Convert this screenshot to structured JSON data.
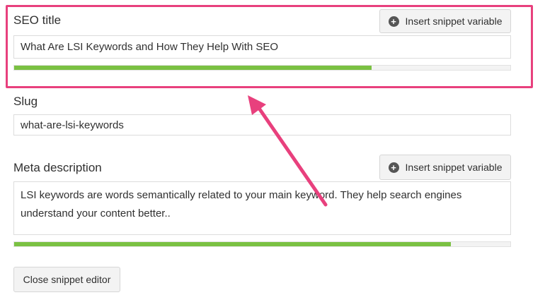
{
  "seo_title": {
    "label": "SEO title",
    "value": "What Are LSI Keywords and How They Help With SEO",
    "insert_button_label": "Insert snippet variable",
    "progress_percent": 72
  },
  "slug": {
    "label": "Slug",
    "value": "what-are-lsi-keywords"
  },
  "meta_description": {
    "label": "Meta description",
    "value": "LSI keywords are words semantically related to your main keyword. They help search engines understand your content better..",
    "insert_button_label": "Insert snippet variable",
    "progress_percent": 88
  },
  "close_button_label": "Close snippet editor",
  "icons": {
    "insert": "plus-circle-icon"
  },
  "colors": {
    "highlight": "#e8407d",
    "progress_good": "#7ac142"
  }
}
